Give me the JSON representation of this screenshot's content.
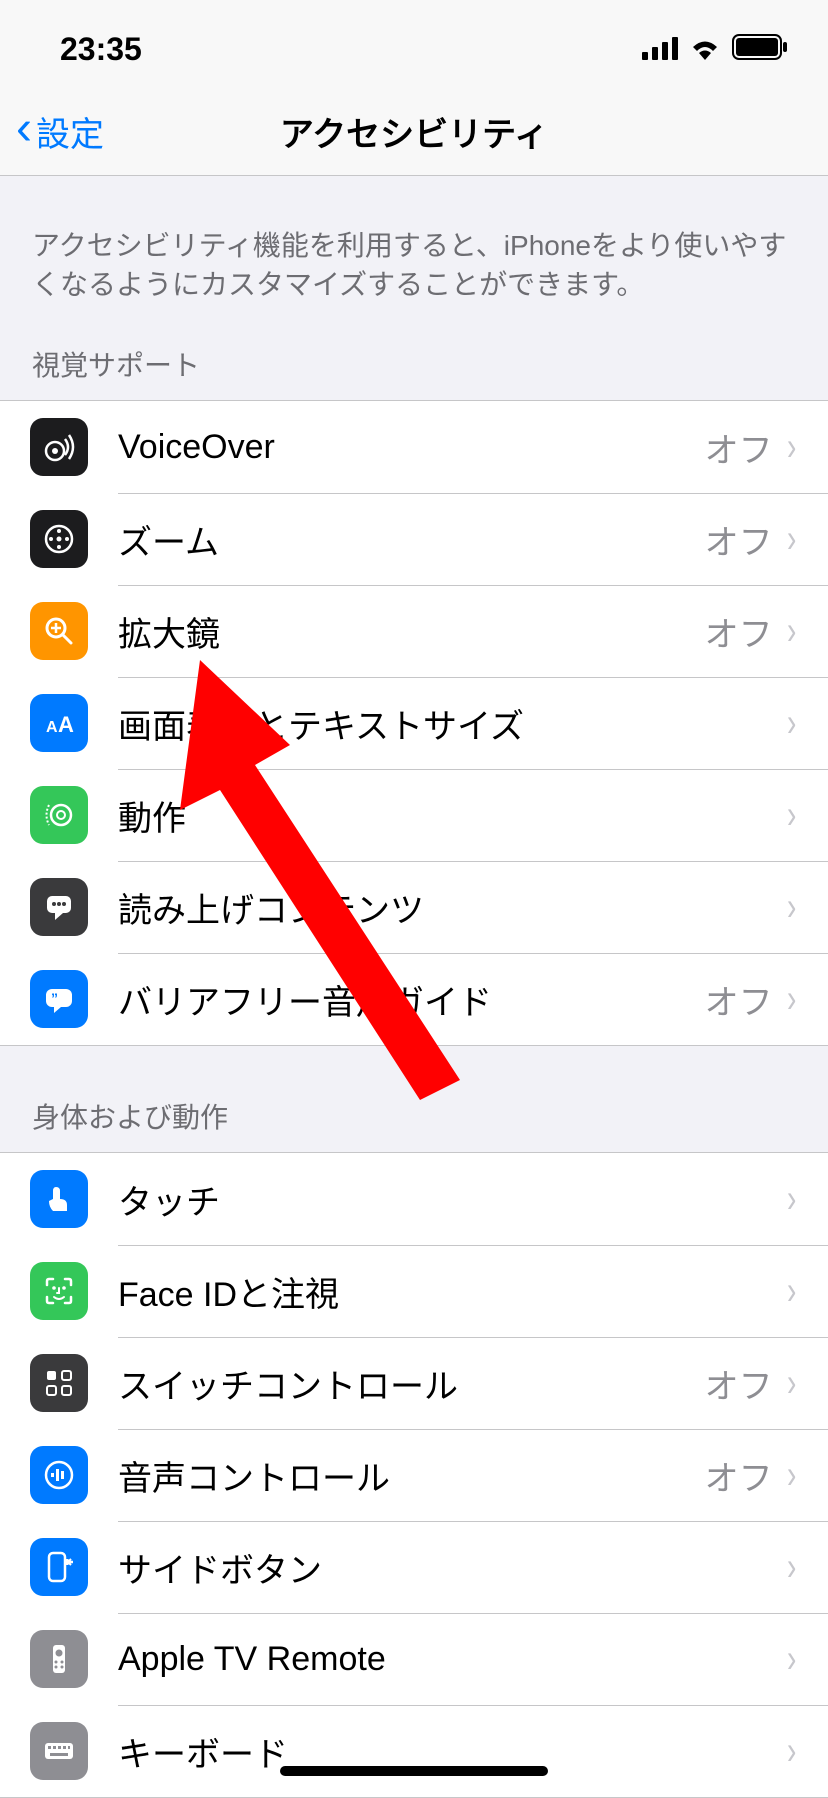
{
  "status": {
    "time": "23:35"
  },
  "nav": {
    "back": "設定",
    "title": "アクセシビリティ"
  },
  "intro": "アクセシビリティ機能を利用すると、iPhoneをより使いやすくなるようにカスタマイズすることができます。",
  "sections": [
    {
      "header": "視覚サポート",
      "items": [
        {
          "label": "VoiceOver",
          "value": "オフ"
        },
        {
          "label": "ズーム",
          "value": "オフ"
        },
        {
          "label": "拡大鏡",
          "value": "オフ"
        },
        {
          "label": "画面表示とテキストサイズ",
          "value": ""
        },
        {
          "label": "動作",
          "value": ""
        },
        {
          "label": "読み上げコンテンツ",
          "value": ""
        },
        {
          "label": "バリアフリー音声ガイド",
          "value": "オフ"
        }
      ]
    },
    {
      "header": "身体および動作",
      "items": [
        {
          "label": "タッチ",
          "value": ""
        },
        {
          "label": "Face IDと注視",
          "value": ""
        },
        {
          "label": "スイッチコントロール",
          "value": "オフ"
        },
        {
          "label": "音声コントロール",
          "value": "オフ"
        },
        {
          "label": "サイドボタン",
          "value": ""
        },
        {
          "label": "Apple TV Remote",
          "value": ""
        },
        {
          "label": "キーボード",
          "value": ""
        }
      ]
    }
  ]
}
